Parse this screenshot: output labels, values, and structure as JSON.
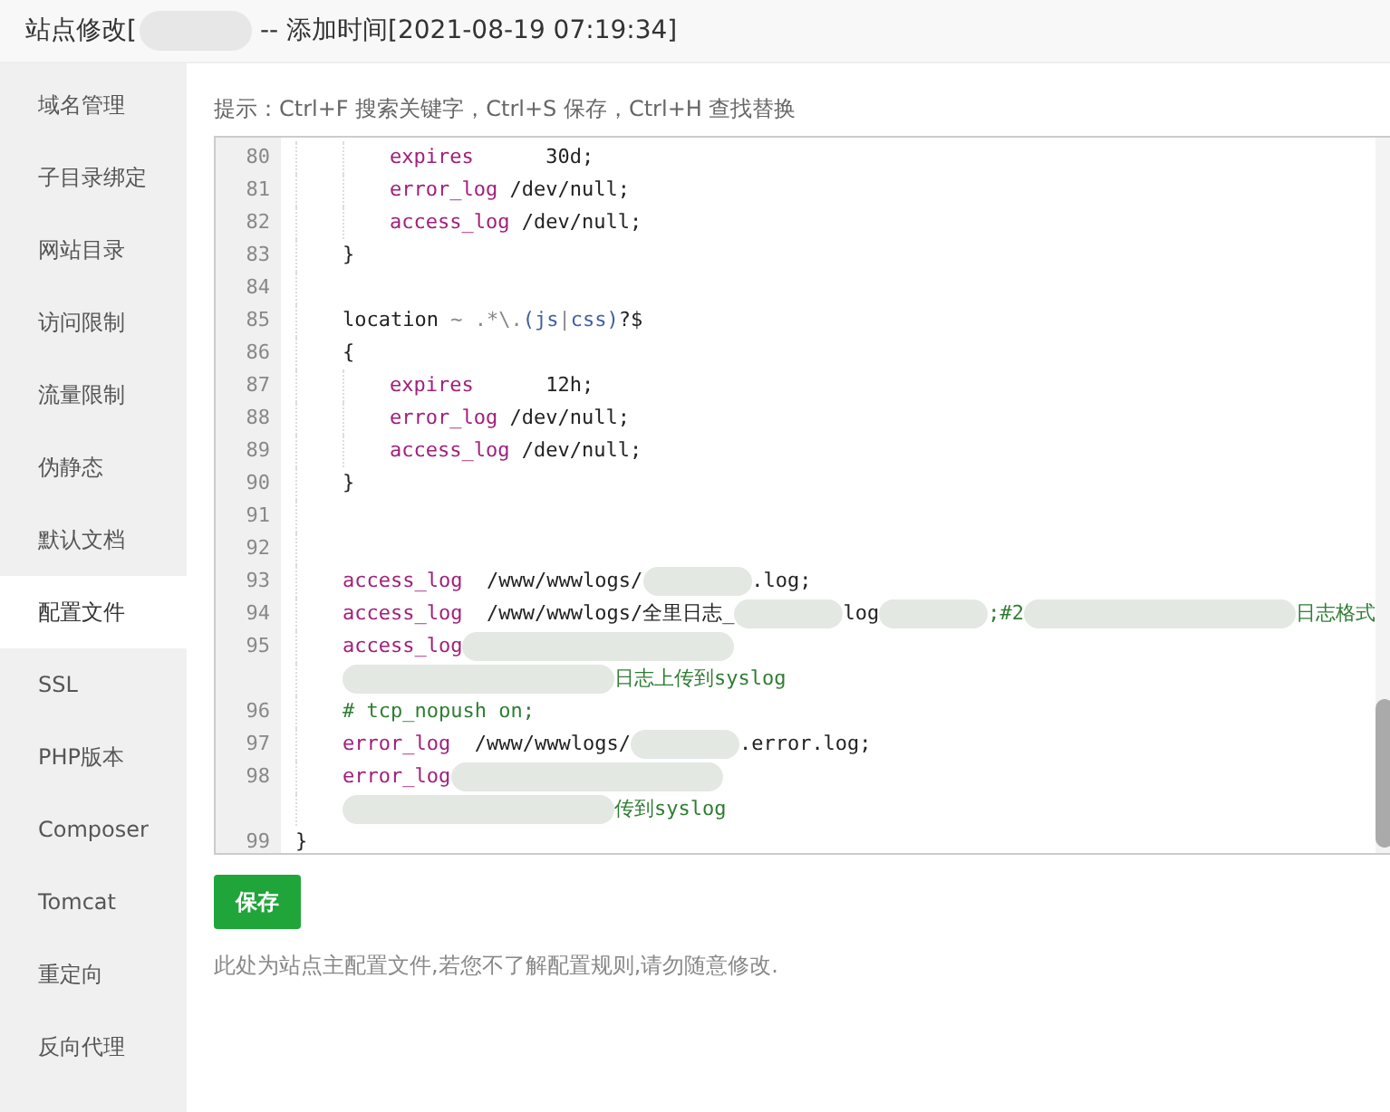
{
  "window": {
    "title_prefix": "站点修改[",
    "title_suffix": "-- 添加时间[2021-08-19 07:19:34]"
  },
  "sidebar": {
    "items": [
      {
        "label": "域名管理",
        "selected": false
      },
      {
        "label": "子目录绑定",
        "selected": false
      },
      {
        "label": "网站目录",
        "selected": false
      },
      {
        "label": "访问限制",
        "selected": false
      },
      {
        "label": "流量限制",
        "selected": false
      },
      {
        "label": "伪静态",
        "selected": false
      },
      {
        "label": "默认文档",
        "selected": false
      },
      {
        "label": "配置文件",
        "selected": true
      },
      {
        "label": "SSL",
        "selected": false
      },
      {
        "label": "PHP版本",
        "selected": false
      },
      {
        "label": "Composer",
        "selected": false
      },
      {
        "label": "Tomcat",
        "selected": false
      },
      {
        "label": "重定向",
        "selected": false
      },
      {
        "label": "反向代理",
        "selected": false
      }
    ]
  },
  "hint": "提示：Ctrl+F 搜索关键字，Ctrl+S 保存，Ctrl+H 查找替换",
  "editor": {
    "lines": [
      {
        "number": "80",
        "segments": [
          {
            "kind": "indent"
          },
          {
            "kind": "indent"
          },
          {
            "kind": "keyword",
            "text": "expires"
          },
          {
            "kind": "plain",
            "text": "      30d;"
          }
        ]
      },
      {
        "number": "81",
        "segments": [
          {
            "kind": "indent"
          },
          {
            "kind": "indent"
          },
          {
            "kind": "keyword",
            "text": "error_log"
          },
          {
            "kind": "plain",
            "text": " /dev/null;"
          }
        ]
      },
      {
        "number": "82",
        "segments": [
          {
            "kind": "indent"
          },
          {
            "kind": "indent"
          },
          {
            "kind": "keyword",
            "text": "access_log"
          },
          {
            "kind": "plain",
            "text": " /dev/null;"
          }
        ]
      },
      {
        "number": "83",
        "segments": [
          {
            "kind": "indent"
          },
          {
            "kind": "plain",
            "text": "}"
          }
        ]
      },
      {
        "number": "84",
        "segments": [
          {
            "kind": "indent"
          }
        ]
      },
      {
        "number": "85",
        "segments": [
          {
            "kind": "indent"
          },
          {
            "kind": "plain",
            "text": "location "
          },
          {
            "kind": "operator",
            "text": "~ .*\\."
          },
          {
            "kind": "regex",
            "text": "(js"
          },
          {
            "kind": "operator",
            "text": "|"
          },
          {
            "kind": "regex",
            "text": "css)"
          },
          {
            "kind": "plain",
            "text": "?$"
          }
        ]
      },
      {
        "number": "86",
        "segments": [
          {
            "kind": "indent"
          },
          {
            "kind": "plain",
            "text": "{"
          }
        ]
      },
      {
        "number": "87",
        "segments": [
          {
            "kind": "indent"
          },
          {
            "kind": "indent"
          },
          {
            "kind": "keyword",
            "text": "expires"
          },
          {
            "kind": "plain",
            "text": "      12h;"
          }
        ]
      },
      {
        "number": "88",
        "segments": [
          {
            "kind": "indent"
          },
          {
            "kind": "indent"
          },
          {
            "kind": "keyword",
            "text": "error_log"
          },
          {
            "kind": "plain",
            "text": " /dev/null;"
          }
        ]
      },
      {
        "number": "89",
        "segments": [
          {
            "kind": "indent"
          },
          {
            "kind": "indent"
          },
          {
            "kind": "keyword",
            "text": "access_log"
          },
          {
            "kind": "plain",
            "text": " /dev/null;"
          }
        ]
      },
      {
        "number": "90",
        "segments": [
          {
            "kind": "indent"
          },
          {
            "kind": "plain",
            "text": "}"
          }
        ]
      },
      {
        "number": "91",
        "segments": [
          {
            "kind": "indent"
          }
        ]
      },
      {
        "number": "92",
        "segments": [
          {
            "kind": "indent"
          }
        ]
      },
      {
        "number": "93",
        "segments": [
          {
            "kind": "indent"
          },
          {
            "kind": "keyword",
            "text": "access_log"
          },
          {
            "kind": "plain",
            "text": "  /www/wwwlogs/"
          },
          {
            "kind": "redacted-short"
          },
          {
            "kind": "plain",
            "text": ".log;"
          }
        ]
      },
      {
        "number": "94",
        "segments": [
          {
            "kind": "indent"
          },
          {
            "kind": "keyword",
            "text": "access_log"
          },
          {
            "kind": "plain",
            "text": "  /www/wwwlogs/全里日志_"
          },
          {
            "kind": "redacted-short"
          },
          {
            "kind": "plain",
            "text": "log"
          },
          {
            "kind": "redacted-short"
          },
          {
            "kind": "comment",
            "text": ";#2"
          },
          {
            "kind": "redacted-long"
          },
          {
            "kind": "comment",
            "text": "日志格式"
          }
        ]
      },
      {
        "number": "95",
        "segments": [
          {
            "kind": "indent"
          },
          {
            "kind": "keyword",
            "text": "access_log"
          },
          {
            "kind": "redacted-long"
          },
          {
            "kind": "newline"
          },
          {
            "kind": "indent"
          },
          {
            "kind": "redacted-long"
          },
          {
            "kind": "comment",
            "text": "日志上传到syslog"
          }
        ]
      },
      {
        "number": "96",
        "segments": [
          {
            "kind": "indent"
          },
          {
            "kind": "comment",
            "text": "# tcp_nopush on;"
          }
        ]
      },
      {
        "number": "97",
        "segments": [
          {
            "kind": "indent"
          },
          {
            "kind": "keyword",
            "text": "error_log"
          },
          {
            "kind": "plain",
            "text": "  /www/wwwlogs/"
          },
          {
            "kind": "redacted-short"
          },
          {
            "kind": "plain",
            "text": ".error.log;"
          }
        ]
      },
      {
        "number": "98",
        "segments": [
          {
            "kind": "indent"
          },
          {
            "kind": "keyword",
            "text": "error_log"
          },
          {
            "kind": "redacted-long"
          },
          {
            "kind": "newline"
          },
          {
            "kind": "indent"
          },
          {
            "kind": "redacted-long"
          },
          {
            "kind": "comment",
            "text": "传到syslog"
          }
        ]
      },
      {
        "number": "99",
        "segments": [
          {
            "kind": "plain",
            "text": "}"
          }
        ]
      }
    ]
  },
  "save_button": "保存",
  "note": "此处为站点主配置文件,若您不了解配置规则,请勿随意修改."
}
